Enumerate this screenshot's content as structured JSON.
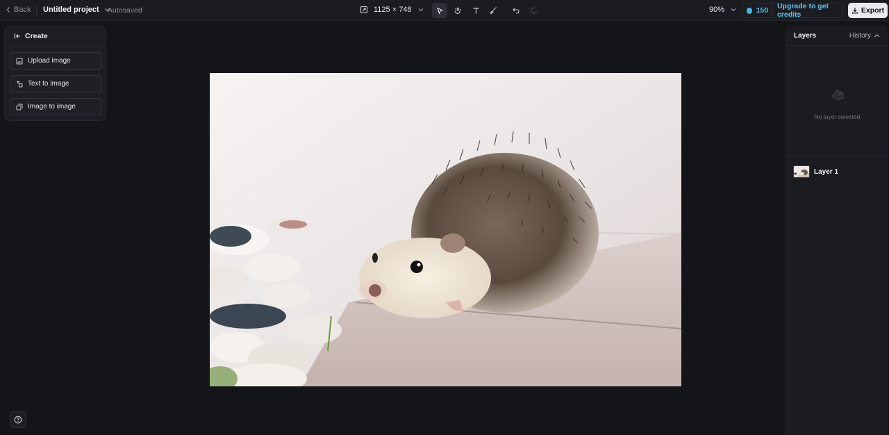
{
  "topbar": {
    "back_label": "Back",
    "project_name": "Untitled project",
    "save_status": "Autosaved",
    "dimensions": "1125 × 748",
    "zoom": "90%",
    "credits": "150",
    "upgrade_label": "Upgrade to get credits",
    "export_label": "Export"
  },
  "create_panel": {
    "title": "Create",
    "buttons": [
      {
        "label": "Upload image"
      },
      {
        "label": "Text to image"
      },
      {
        "label": "Image to image"
      }
    ]
  },
  "layers_panel": {
    "title": "Layers",
    "history_label": "History",
    "empty_state": "No layer selected",
    "layers": [
      {
        "name": "Layer 1"
      }
    ]
  },
  "colors": {
    "background": "#131519",
    "panel": "#1c1e23",
    "accent": "#5ec4ef",
    "export_bg": "#e8eaee"
  },
  "icons": {
    "back": "chevron-left-icon",
    "dropdown": "chevron-down-icon",
    "resize": "resize-icon",
    "select": "pointer-icon",
    "hand": "hand-icon",
    "text": "text-icon",
    "brush": "brush-icon",
    "undo": "undo-icon",
    "redo": "redo-icon",
    "credit": "coin-icon",
    "export": "download-icon",
    "create": "arrow-left-bar-icon",
    "help": "help-icon"
  }
}
